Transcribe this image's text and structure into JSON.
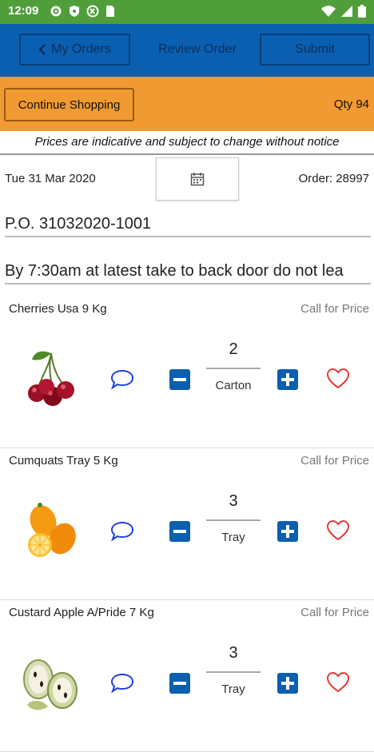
{
  "status_bar": {
    "time": "12:09"
  },
  "app_bar": {
    "back_label": "My Orders",
    "title": "Review Order",
    "submit_label": "Submit"
  },
  "shop_bar": {
    "continue_label": "Continue Shopping",
    "qty_text": "Qty 94"
  },
  "notice": "Prices are indicative and subject to change without notice",
  "order_info": {
    "date": "Tue 31 Mar 2020",
    "order_number": "Order: 28997",
    "po": "P.O. 31032020-1001",
    "delivery_note": "By 7:30am at latest take to back door do not lea"
  },
  "products": [
    {
      "name": "Cherries Usa 9 Kg",
      "price": "Call for Price",
      "quantity": "2",
      "unit": "Carton",
      "image_icon": "cherries-image"
    },
    {
      "name": "Cumquats Tray 5 Kg",
      "price": "Call for Price",
      "quantity": "3",
      "unit": "Tray",
      "image_icon": "cumquats-image"
    },
    {
      "name": "Custard Apple A/Pride 7 Kg",
      "price": "Call for Price",
      "quantity": "3",
      "unit": "Tray",
      "image_icon": "custard-apple-image"
    }
  ],
  "colors": {
    "status_bar": "#4f9e3a",
    "app_bar": "#0a5fb1",
    "shop_bar": "#f09a31",
    "heart": "#e53935",
    "comment": "#1e3fe0"
  }
}
